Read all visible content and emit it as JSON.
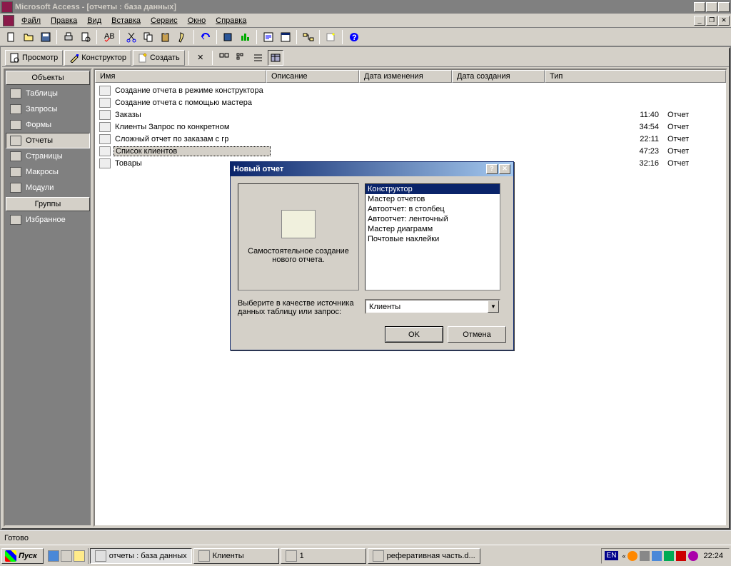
{
  "app": {
    "title": "Microsoft Access - [отчеты : база данных]"
  },
  "menu": {
    "items": [
      "Файл",
      "Правка",
      "Вид",
      "Вставка",
      "Сервис",
      "Окно",
      "Справка"
    ]
  },
  "db_toolbar": {
    "open": "Просмотр",
    "design": "Конструктор",
    "new": "Создать"
  },
  "sidebar": {
    "objects_header": "Объекты",
    "groups_header": "Группы",
    "items": [
      "Таблицы",
      "Запросы",
      "Формы",
      "Отчеты",
      "Страницы",
      "Макросы",
      "Модули"
    ],
    "fav": "Избранное"
  },
  "list": {
    "cols": [
      "Имя",
      "Описание",
      "Дата изменения",
      "Дата создания",
      "Тип"
    ],
    "rows": [
      {
        "name": "Создание отчета в режиме конструктора",
        "time": "",
        "type": ""
      },
      {
        "name": "Создание отчета с помощью мастера",
        "time": "",
        "type": ""
      },
      {
        "name": "Заказы",
        "time": "11:40",
        "type": "Отчет"
      },
      {
        "name": "Клиенты Запрос по конкретном",
        "time": "34:54",
        "type": "Отчет"
      },
      {
        "name": "Сложный отчет по заказам с гр",
        "time": "22:11",
        "type": "Отчет"
      },
      {
        "name": "Список клиентов",
        "time": "47:23",
        "type": "Отчет"
      },
      {
        "name": "Товары",
        "time": "32:16",
        "type": "Отчет"
      }
    ]
  },
  "dialog": {
    "title": "Новый отчет",
    "preview_text": "Самостоятельное создание нового отчета.",
    "options": [
      "Конструктор",
      "Мастер отчетов",
      "Автоотчет: в столбец",
      "Автоотчет: ленточный",
      "Мастер диаграмм",
      "Почтовые наклейки"
    ],
    "prompt": "Выберите в качестве источника данных таблицу или запрос:",
    "combo_value": "Клиенты",
    "ok": "OK",
    "cancel": "Отмена"
  },
  "status": {
    "text": "Готово"
  },
  "taskbar": {
    "start": "Пуск",
    "tasks": [
      {
        "label": "отчеты : база данных",
        "active": true
      },
      {
        "label": "Клиенты",
        "active": false
      },
      {
        "label": "1",
        "active": false
      },
      {
        "label": "реферативная часть.d...",
        "active": false
      }
    ],
    "lang": "EN",
    "clock": "22:24"
  }
}
